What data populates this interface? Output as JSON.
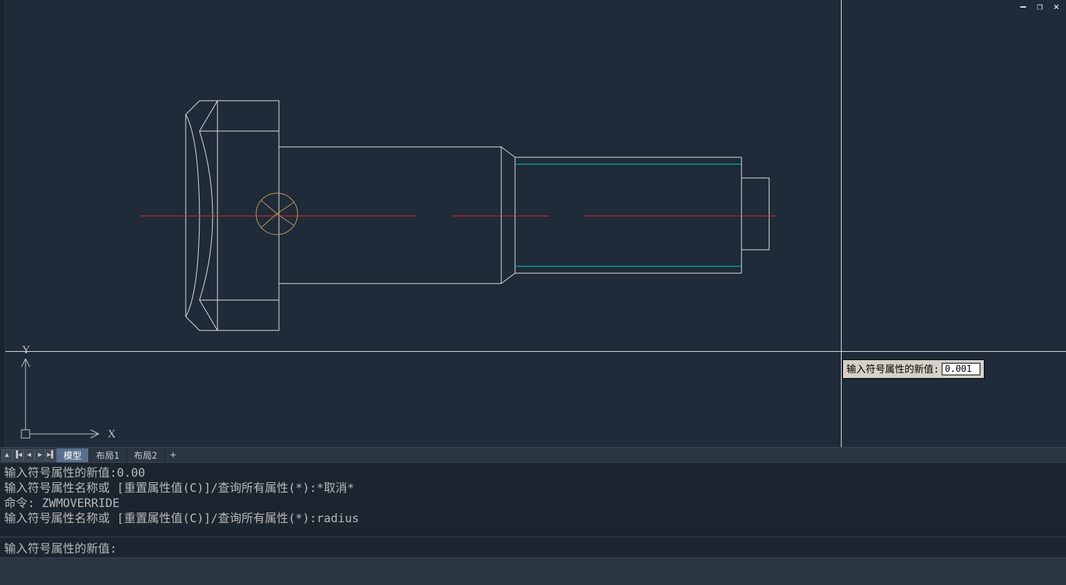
{
  "window": {
    "minimize": "—",
    "maximize": "❐",
    "close": "✕"
  },
  "tabs": {
    "model": "模型",
    "layout1": "布局1",
    "layout2": "布局2",
    "add": "+"
  },
  "tooltip": {
    "label": "输入符号属性的新值:",
    "value": "0.001"
  },
  "ucs": {
    "x_label": "X",
    "y_label": "Y"
  },
  "command_history": {
    "line1": "输入符号属性的新值:0.00",
    "line2": "输入符号属性名称或 [重置属性值(C)]/查询所有属性(*):*取消*",
    "line3": "命令: ZWMOVERRIDE",
    "line4": "输入符号属性名称或 [重置属性值(C)]/查询所有属性(*):radius"
  },
  "command_prompt": "输入符号属性的新值:",
  "nav": {
    "up": "▲",
    "first": "▐◀",
    "prev": "◀",
    "next": "▶",
    "last": "▶▌"
  }
}
